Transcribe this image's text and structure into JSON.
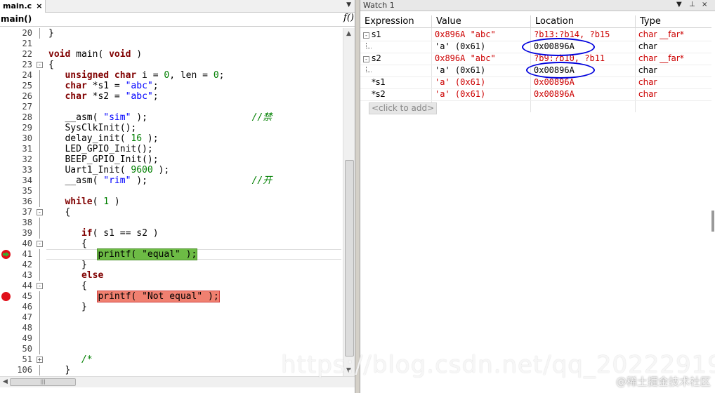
{
  "editor": {
    "tab_label": "main.c",
    "tab_close": "×",
    "tab_dropdown": "▼",
    "function_name": "main()",
    "function_icon": "f()",
    "lines": [
      {
        "num": "20",
        "tokens": [
          {
            "t": "}",
            "c": ""
          }
        ],
        "fold": "",
        "guide": true
      },
      {
        "num": "21",
        "tokens": [],
        "fold": "",
        "guide": false
      },
      {
        "num": "22",
        "tokens": [
          {
            "t": "void",
            "c": "kw"
          },
          {
            "t": " main( ",
            "c": ""
          },
          {
            "t": "void",
            "c": "kw"
          },
          {
            "t": " )",
            "c": ""
          }
        ],
        "fold": "",
        "guide": false
      },
      {
        "num": "23",
        "tokens": [
          {
            "t": "{",
            "c": ""
          }
        ],
        "fold": "-",
        "guide": false
      },
      {
        "num": "24",
        "tokens": [
          {
            "t": "   ",
            "c": ""
          },
          {
            "t": "unsigned char",
            "c": "kw"
          },
          {
            "t": " i = ",
            "c": ""
          },
          {
            "t": "0",
            "c": "num"
          },
          {
            "t": ", len = ",
            "c": ""
          },
          {
            "t": "0",
            "c": "num"
          },
          {
            "t": ";",
            "c": ""
          }
        ],
        "fold": "",
        "guide": true
      },
      {
        "num": "25",
        "tokens": [
          {
            "t": "   ",
            "c": ""
          },
          {
            "t": "char",
            "c": "kw"
          },
          {
            "t": " *s1 = ",
            "c": ""
          },
          {
            "t": "\"abc\"",
            "c": "str"
          },
          {
            "t": ";",
            "c": ""
          }
        ],
        "fold": "",
        "guide": true
      },
      {
        "num": "26",
        "tokens": [
          {
            "t": "   ",
            "c": ""
          },
          {
            "t": "char",
            "c": "kw"
          },
          {
            "t": " *s2 = ",
            "c": ""
          },
          {
            "t": "\"abc\"",
            "c": "str"
          },
          {
            "t": ";",
            "c": ""
          }
        ],
        "fold": "",
        "guide": true
      },
      {
        "num": "27",
        "tokens": [],
        "fold": "",
        "guide": true
      },
      {
        "num": "28",
        "tokens": [
          {
            "t": "   __asm( ",
            "c": ""
          },
          {
            "t": "\"sim\"",
            "c": "str"
          },
          {
            "t": " );                   ",
            "c": ""
          },
          {
            "t": "//禁",
            "c": "cmt"
          }
        ],
        "fold": "",
        "guide": true
      },
      {
        "num": "29",
        "tokens": [
          {
            "t": "   SysClkInit();",
            "c": ""
          }
        ],
        "fold": "",
        "guide": true
      },
      {
        "num": "30",
        "tokens": [
          {
            "t": "   delay_init( ",
            "c": ""
          },
          {
            "t": "16",
            "c": "num"
          },
          {
            "t": " );",
            "c": ""
          }
        ],
        "fold": "",
        "guide": true
      },
      {
        "num": "31",
        "tokens": [
          {
            "t": "   LED_GPIO_Init();",
            "c": ""
          }
        ],
        "fold": "",
        "guide": true
      },
      {
        "num": "32",
        "tokens": [
          {
            "t": "   BEEP_GPIO_Init();",
            "c": ""
          }
        ],
        "fold": "",
        "guide": true
      },
      {
        "num": "33",
        "tokens": [
          {
            "t": "   Uart1_Init( ",
            "c": ""
          },
          {
            "t": "9600",
            "c": "num"
          },
          {
            "t": " );",
            "c": ""
          }
        ],
        "fold": "",
        "guide": true
      },
      {
        "num": "34",
        "tokens": [
          {
            "t": "   __asm( ",
            "c": ""
          },
          {
            "t": "\"rim\"",
            "c": "str"
          },
          {
            "t": " );                   ",
            "c": ""
          },
          {
            "t": "//开",
            "c": "cmt"
          }
        ],
        "fold": "",
        "guide": true
      },
      {
        "num": "35",
        "tokens": [],
        "fold": "",
        "guide": true
      },
      {
        "num": "36",
        "tokens": [
          {
            "t": "   ",
            "c": ""
          },
          {
            "t": "while",
            "c": "kw"
          },
          {
            "t": "( ",
            "c": ""
          },
          {
            "t": "1",
            "c": "num"
          },
          {
            "t": " )",
            "c": ""
          }
        ],
        "fold": "",
        "guide": true
      },
      {
        "num": "37",
        "tokens": [
          {
            "t": "   {",
            "c": ""
          }
        ],
        "fold": "-",
        "guide": false
      },
      {
        "num": "38",
        "tokens": [],
        "fold": "",
        "guide": true
      },
      {
        "num": "39",
        "tokens": [
          {
            "t": "      ",
            "c": ""
          },
          {
            "t": "if",
            "c": "kw"
          },
          {
            "t": "( s1 == s2 )",
            "c": ""
          }
        ],
        "fold": "",
        "guide": true
      },
      {
        "num": "40",
        "tokens": [
          {
            "t": "      {",
            "c": ""
          }
        ],
        "fold": "-",
        "guide": false
      },
      {
        "num": "41",
        "tokens": [
          {
            "t": "         ",
            "c": ""
          },
          {
            "t": "printf( \"equal\" );",
            "c": "hl-green"
          }
        ],
        "fold": "",
        "guide": true,
        "marker": "current"
      },
      {
        "num": "42",
        "tokens": [
          {
            "t": "      }",
            "c": ""
          }
        ],
        "fold": "",
        "guide": true
      },
      {
        "num": "43",
        "tokens": [
          {
            "t": "      ",
            "c": ""
          },
          {
            "t": "else",
            "c": "kw"
          }
        ],
        "fold": "",
        "guide": true
      },
      {
        "num": "44",
        "tokens": [
          {
            "t": "      {",
            "c": ""
          }
        ],
        "fold": "-",
        "guide": false
      },
      {
        "num": "45",
        "tokens": [
          {
            "t": "         ",
            "c": ""
          },
          {
            "t": "printf( \"Not equal\" );",
            "c": "hl-red"
          }
        ],
        "fold": "",
        "guide": true,
        "marker": "breakpoint"
      },
      {
        "num": "46",
        "tokens": [
          {
            "t": "      }",
            "c": ""
          }
        ],
        "fold": "",
        "guide": true
      },
      {
        "num": "47",
        "tokens": [],
        "fold": "",
        "guide": true
      },
      {
        "num": "48",
        "tokens": [],
        "fold": "",
        "guide": true
      },
      {
        "num": "49",
        "tokens": [],
        "fold": "",
        "guide": true
      },
      {
        "num": "50",
        "tokens": [],
        "fold": "",
        "guide": true
      },
      {
        "num": "51",
        "tokens": [
          {
            "t": "      ",
            "c": ""
          },
          {
            "t": "/*",
            "c": "cmt"
          }
        ],
        "fold": "+",
        "guide": false
      },
      {
        "num": "106",
        "tokens": [
          {
            "t": "   }",
            "c": ""
          }
        ],
        "fold": "",
        "guide": true
      }
    ]
  },
  "watch": {
    "title": "Watch 1",
    "controls": [
      "▼",
      "⊥",
      "×"
    ],
    "columns": [
      "Expression",
      "Value",
      "Location",
      "Type"
    ],
    "rows": [
      {
        "expr": "s1",
        "expander": "-",
        "indent": 0,
        "value": "0x896A \"abc\"",
        "value_color": "red",
        "location": "?b13:?b14, ?b15",
        "loc_color": "red",
        "type": "char __far*",
        "type_color": "red"
      },
      {
        "expr": "",
        "expander": "",
        "indent": 1,
        "value": "'a' (0x61)",
        "value_color": "black",
        "location": "0x00896A",
        "loc_color": "black",
        "type": "char",
        "type_color": "black"
      },
      {
        "expr": "s2",
        "expander": "-",
        "indent": 0,
        "value": "0x896A \"abc\"",
        "value_color": "red",
        "location": "?b9:?b10, ?b11",
        "loc_color": "red",
        "type": "char __far*",
        "type_color": "red"
      },
      {
        "expr": "",
        "expander": "",
        "indent": 1,
        "value": "'a' (0x61)",
        "value_color": "black",
        "location": "0x00896A",
        "loc_color": "black",
        "type": "char",
        "type_color": "black"
      },
      {
        "expr": "*s1",
        "expander": "",
        "indent": 0,
        "value": "'a' (0x61)",
        "value_color": "red",
        "location": "0x00896A",
        "loc_color": "red",
        "type": "char",
        "type_color": "red"
      },
      {
        "expr": "*s2",
        "expander": "",
        "indent": 0,
        "value": "'a' (0x61)",
        "value_color": "red",
        "location": "0x00896A",
        "loc_color": "red",
        "type": "char",
        "type_color": "red"
      }
    ],
    "click_to_add": "<click to add>"
  },
  "overlay": {
    "watermark": "https://blog.csdn.net/qq_20222919",
    "credit": "@稀土掘金技术社区"
  },
  "colors": {
    "keyword": "#800000",
    "string": "#0000ff",
    "number": "#007f00",
    "watch_changed": "#cc0000",
    "highlight_green": "#6dbb45",
    "highlight_red": "#f08070",
    "annotation_ellipse": "#0000dd"
  }
}
